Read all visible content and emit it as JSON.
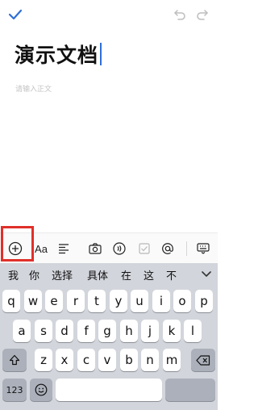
{
  "top_bar": {
    "done_icon": "checkmark-icon",
    "undo_icon": "undo-icon",
    "redo_icon": "redo-icon"
  },
  "document": {
    "title": "演示文档",
    "body_placeholder": "请输入正文"
  },
  "format_toolbar": {
    "buttons": [
      {
        "name": "insert-plus-icon"
      },
      {
        "name": "text-style-icon",
        "label": "Aa"
      },
      {
        "name": "align-icon"
      },
      {
        "name": "camera-icon"
      },
      {
        "name": "voice-icon"
      },
      {
        "name": "checkbox-icon"
      },
      {
        "name": "mention-icon"
      },
      {
        "name": "keyboard-hide-icon"
      }
    ],
    "highlighted": "insert-plus-icon"
  },
  "keyboard": {
    "suggestions": [
      "我",
      "你",
      "选择",
      "具体",
      "在",
      "这",
      "不"
    ],
    "row1": [
      "q",
      "w",
      "e",
      "r",
      "t",
      "y",
      "u",
      "i",
      "o",
      "p"
    ],
    "row2": [
      "a",
      "s",
      "d",
      "f",
      "g",
      "h",
      "j",
      "k",
      "l"
    ],
    "row3": [
      "z",
      "x",
      "c",
      "v",
      "b",
      "n",
      "m"
    ],
    "numbers_key": "123"
  },
  "colors": {
    "caret": "#2f6fd6",
    "highlight": "#e0302a",
    "accent": "#2f6fd6"
  }
}
